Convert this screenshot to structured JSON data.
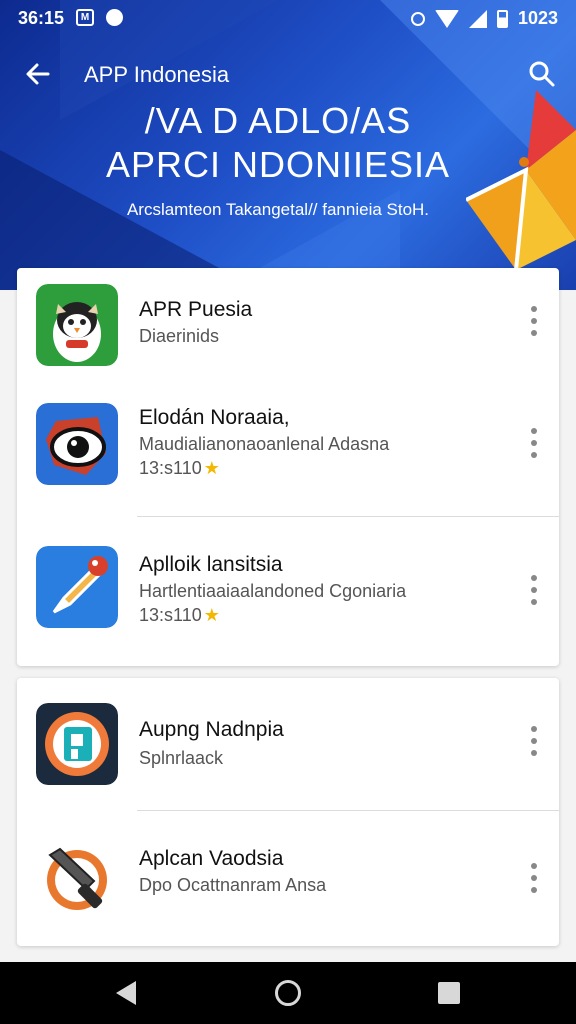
{
  "status": {
    "time": "36:15",
    "right_text": "1023"
  },
  "toolbar": {
    "title": "APP Indonesia"
  },
  "hero": {
    "line1": "/VA D ADLO/AS",
    "line2": "APRCI NDONIIESIA",
    "subtitle": "Arcslamteon Takangetal// fannieia StoH."
  },
  "apps": [
    {
      "name": "APR Puesia",
      "desc": "Diaerinids",
      "meta": "",
      "icon": "penguin-mascot-icon",
      "color": "#2e9e3c"
    },
    {
      "name": "Elodán Noraaia,",
      "desc": "Maudialianonaoanlenal Adasna",
      "meta": "13:s110",
      "icon": "eye-mascot-icon",
      "color": "#2a6fd6"
    },
    {
      "name": "Aplloik lansitsia",
      "desc": "Hartlentiaaiaalandoned Cgoniaria",
      "meta": "13:s110",
      "icon": "pen-tool-icon",
      "color": "#2a7ee0"
    },
    {
      "name": "Aupng Nadnpia",
      "desc": "Splnrlaack",
      "meta": "",
      "icon": "p-logo-icon",
      "color": "#1b2a3c"
    },
    {
      "name": "Aplcan Vaodsia",
      "desc": "Dpo Ocattnanram Ansa",
      "meta": "",
      "icon": "knife-tool-icon",
      "color": "#ffffff"
    }
  ],
  "colors": {
    "header_blue": "#1f4fc7",
    "star": "#f5b800"
  }
}
